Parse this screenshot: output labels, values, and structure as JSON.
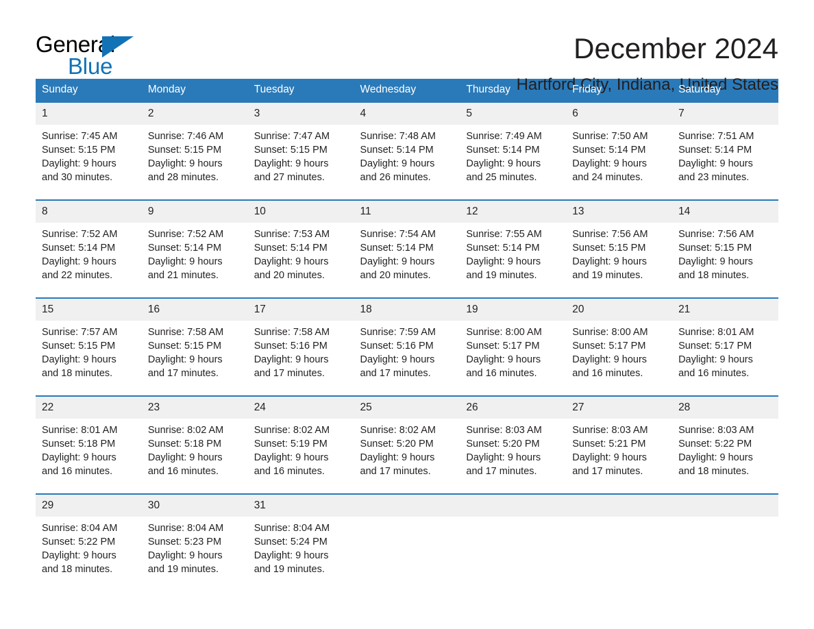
{
  "brand": {
    "name_part1": "General",
    "name_part2": "Blue",
    "logo_icon": "triangle-flag-icon",
    "color_blue": "#1272b6"
  },
  "header": {
    "title": "December 2024",
    "location": "Hartford City, Indiana, United States"
  },
  "theme": {
    "header_blue": "#2a7ab9",
    "row_divider_blue": "#2a7ab9",
    "daynum_band": "#f0f0f0",
    "text": "#231f20"
  },
  "calendar": {
    "weekday_headers": [
      "Sunday",
      "Monday",
      "Tuesday",
      "Wednesday",
      "Thursday",
      "Friday",
      "Saturday"
    ],
    "weeks": [
      [
        {
          "day": "1",
          "sunrise": "Sunrise: 7:45 AM",
          "sunset": "Sunset: 5:15 PM",
          "daylight_line1": "Daylight: 9 hours",
          "daylight_line2": "and 30 minutes."
        },
        {
          "day": "2",
          "sunrise": "Sunrise: 7:46 AM",
          "sunset": "Sunset: 5:15 PM",
          "daylight_line1": "Daylight: 9 hours",
          "daylight_line2": "and 28 minutes."
        },
        {
          "day": "3",
          "sunrise": "Sunrise: 7:47 AM",
          "sunset": "Sunset: 5:15 PM",
          "daylight_line1": "Daylight: 9 hours",
          "daylight_line2": "and 27 minutes."
        },
        {
          "day": "4",
          "sunrise": "Sunrise: 7:48 AM",
          "sunset": "Sunset: 5:14 PM",
          "daylight_line1": "Daylight: 9 hours",
          "daylight_line2": "and 26 minutes."
        },
        {
          "day": "5",
          "sunrise": "Sunrise: 7:49 AM",
          "sunset": "Sunset: 5:14 PM",
          "daylight_line1": "Daylight: 9 hours",
          "daylight_line2": "and 25 minutes."
        },
        {
          "day": "6",
          "sunrise": "Sunrise: 7:50 AM",
          "sunset": "Sunset: 5:14 PM",
          "daylight_line1": "Daylight: 9 hours",
          "daylight_line2": "and 24 minutes."
        },
        {
          "day": "7",
          "sunrise": "Sunrise: 7:51 AM",
          "sunset": "Sunset: 5:14 PM",
          "daylight_line1": "Daylight: 9 hours",
          "daylight_line2": "and 23 minutes."
        }
      ],
      [
        {
          "day": "8",
          "sunrise": "Sunrise: 7:52 AM",
          "sunset": "Sunset: 5:14 PM",
          "daylight_line1": "Daylight: 9 hours",
          "daylight_line2": "and 22 minutes."
        },
        {
          "day": "9",
          "sunrise": "Sunrise: 7:52 AM",
          "sunset": "Sunset: 5:14 PM",
          "daylight_line1": "Daylight: 9 hours",
          "daylight_line2": "and 21 minutes."
        },
        {
          "day": "10",
          "sunrise": "Sunrise: 7:53 AM",
          "sunset": "Sunset: 5:14 PM",
          "daylight_line1": "Daylight: 9 hours",
          "daylight_line2": "and 20 minutes."
        },
        {
          "day": "11",
          "sunrise": "Sunrise: 7:54 AM",
          "sunset": "Sunset: 5:14 PM",
          "daylight_line1": "Daylight: 9 hours",
          "daylight_line2": "and 20 minutes."
        },
        {
          "day": "12",
          "sunrise": "Sunrise: 7:55 AM",
          "sunset": "Sunset: 5:14 PM",
          "daylight_line1": "Daylight: 9 hours",
          "daylight_line2": "and 19 minutes."
        },
        {
          "day": "13",
          "sunrise": "Sunrise: 7:56 AM",
          "sunset": "Sunset: 5:15 PM",
          "daylight_line1": "Daylight: 9 hours",
          "daylight_line2": "and 19 minutes."
        },
        {
          "day": "14",
          "sunrise": "Sunrise: 7:56 AM",
          "sunset": "Sunset: 5:15 PM",
          "daylight_line1": "Daylight: 9 hours",
          "daylight_line2": "and 18 minutes."
        }
      ],
      [
        {
          "day": "15",
          "sunrise": "Sunrise: 7:57 AM",
          "sunset": "Sunset: 5:15 PM",
          "daylight_line1": "Daylight: 9 hours",
          "daylight_line2": "and 18 minutes."
        },
        {
          "day": "16",
          "sunrise": "Sunrise: 7:58 AM",
          "sunset": "Sunset: 5:15 PM",
          "daylight_line1": "Daylight: 9 hours",
          "daylight_line2": "and 17 minutes."
        },
        {
          "day": "17",
          "sunrise": "Sunrise: 7:58 AM",
          "sunset": "Sunset: 5:16 PM",
          "daylight_line1": "Daylight: 9 hours",
          "daylight_line2": "and 17 minutes."
        },
        {
          "day": "18",
          "sunrise": "Sunrise: 7:59 AM",
          "sunset": "Sunset: 5:16 PM",
          "daylight_line1": "Daylight: 9 hours",
          "daylight_line2": "and 17 minutes."
        },
        {
          "day": "19",
          "sunrise": "Sunrise: 8:00 AM",
          "sunset": "Sunset: 5:17 PM",
          "daylight_line1": "Daylight: 9 hours",
          "daylight_line2": "and 16 minutes."
        },
        {
          "day": "20",
          "sunrise": "Sunrise: 8:00 AM",
          "sunset": "Sunset: 5:17 PM",
          "daylight_line1": "Daylight: 9 hours",
          "daylight_line2": "and 16 minutes."
        },
        {
          "day": "21",
          "sunrise": "Sunrise: 8:01 AM",
          "sunset": "Sunset: 5:17 PM",
          "daylight_line1": "Daylight: 9 hours",
          "daylight_line2": "and 16 minutes."
        }
      ],
      [
        {
          "day": "22",
          "sunrise": "Sunrise: 8:01 AM",
          "sunset": "Sunset: 5:18 PM",
          "daylight_line1": "Daylight: 9 hours",
          "daylight_line2": "and 16 minutes."
        },
        {
          "day": "23",
          "sunrise": "Sunrise: 8:02 AM",
          "sunset": "Sunset: 5:18 PM",
          "daylight_line1": "Daylight: 9 hours",
          "daylight_line2": "and 16 minutes."
        },
        {
          "day": "24",
          "sunrise": "Sunrise: 8:02 AM",
          "sunset": "Sunset: 5:19 PM",
          "daylight_line1": "Daylight: 9 hours",
          "daylight_line2": "and 16 minutes."
        },
        {
          "day": "25",
          "sunrise": "Sunrise: 8:02 AM",
          "sunset": "Sunset: 5:20 PM",
          "daylight_line1": "Daylight: 9 hours",
          "daylight_line2": "and 17 minutes."
        },
        {
          "day": "26",
          "sunrise": "Sunrise: 8:03 AM",
          "sunset": "Sunset: 5:20 PM",
          "daylight_line1": "Daylight: 9 hours",
          "daylight_line2": "and 17 minutes."
        },
        {
          "day": "27",
          "sunrise": "Sunrise: 8:03 AM",
          "sunset": "Sunset: 5:21 PM",
          "daylight_line1": "Daylight: 9 hours",
          "daylight_line2": "and 17 minutes."
        },
        {
          "day": "28",
          "sunrise": "Sunrise: 8:03 AM",
          "sunset": "Sunset: 5:22 PM",
          "daylight_line1": "Daylight: 9 hours",
          "daylight_line2": "and 18 minutes."
        }
      ],
      [
        {
          "day": "29",
          "sunrise": "Sunrise: 8:04 AM",
          "sunset": "Sunset: 5:22 PM",
          "daylight_line1": "Daylight: 9 hours",
          "daylight_line2": "and 18 minutes."
        },
        {
          "day": "30",
          "sunrise": "Sunrise: 8:04 AM",
          "sunset": "Sunset: 5:23 PM",
          "daylight_line1": "Daylight: 9 hours",
          "daylight_line2": "and 19 minutes."
        },
        {
          "day": "31",
          "sunrise": "Sunrise: 8:04 AM",
          "sunset": "Sunset: 5:24 PM",
          "daylight_line1": "Daylight: 9 hours",
          "daylight_line2": "and 19 minutes."
        },
        {
          "day": "",
          "sunrise": "",
          "sunset": "",
          "daylight_line1": "",
          "daylight_line2": ""
        },
        {
          "day": "",
          "sunrise": "",
          "sunset": "",
          "daylight_line1": "",
          "daylight_line2": ""
        },
        {
          "day": "",
          "sunrise": "",
          "sunset": "",
          "daylight_line1": "",
          "daylight_line2": ""
        },
        {
          "day": "",
          "sunrise": "",
          "sunset": "",
          "daylight_line1": "",
          "daylight_line2": ""
        }
      ]
    ]
  }
}
